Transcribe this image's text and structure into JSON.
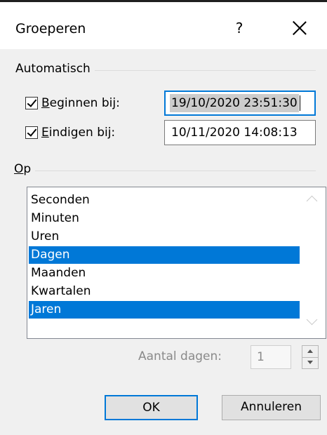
{
  "dialog": {
    "title": "Groeperen",
    "help_label": "?",
    "close_label": "×"
  },
  "automatic": {
    "group_label": "Automatisch",
    "start": {
      "checked": true,
      "label_first": "B",
      "label_rest": "eginnen bij:",
      "value": "19/10/2020 23:51:30"
    },
    "end": {
      "checked": true,
      "label_first": "E",
      "label_rest": "indigen bij:",
      "value": "10/11/2020 14:08:13"
    }
  },
  "by": {
    "group_label_first": "O",
    "group_label_rest": "p",
    "items": [
      {
        "label": "Seconden",
        "selected": false
      },
      {
        "label": "Minuten",
        "selected": false
      },
      {
        "label": "Uren",
        "selected": false
      },
      {
        "label": "Dagen",
        "selected": true
      },
      {
        "label": "Maanden",
        "selected": false
      },
      {
        "label": "Kwartalen",
        "selected": false
      },
      {
        "label": "Jaren",
        "selected": true
      }
    ]
  },
  "days": {
    "label": "Aantal dagen:",
    "value": "1",
    "enabled": false
  },
  "buttons": {
    "ok": "OK",
    "cancel": "Annuleren"
  },
  "colors": {
    "selection": "#0078d7",
    "focus_border": "#0078d7",
    "dialog_bg": "#f0f0f0"
  }
}
